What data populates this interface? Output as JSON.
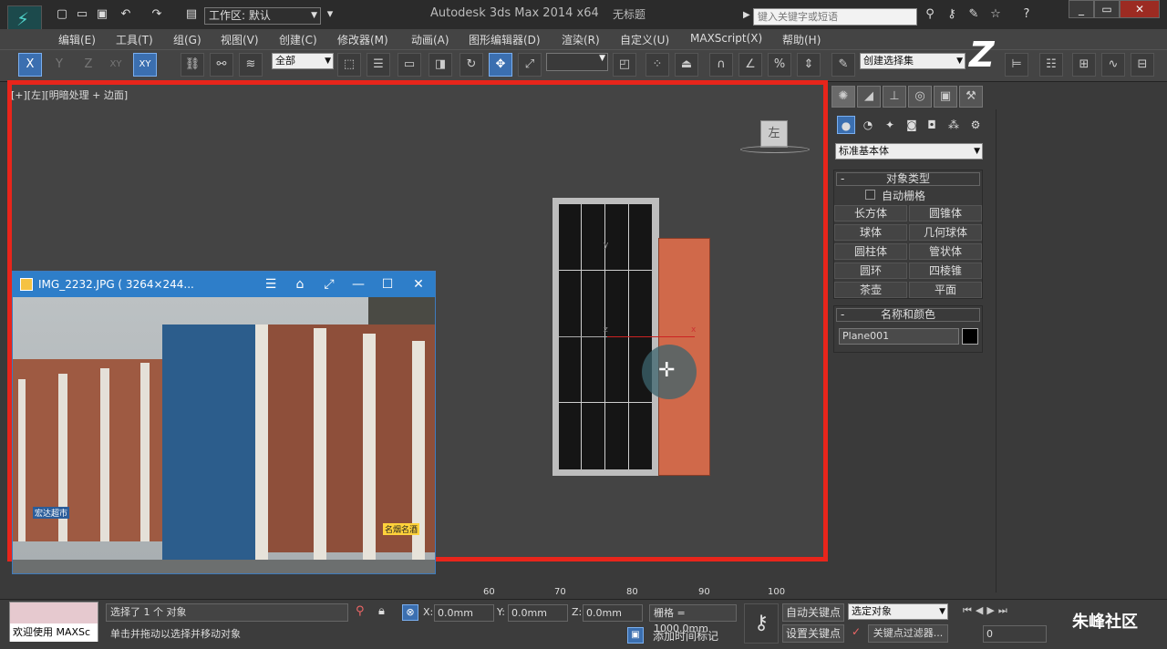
{
  "app": {
    "title": "Autodesk 3ds Max  2014 x64",
    "document": "无标题",
    "workspace": "工作区: 默认",
    "search_placeholder": "键入关键字或短语"
  },
  "menus": [
    "编辑(E)",
    "工具(T)",
    "组(G)",
    "视图(V)",
    "创建(C)",
    "修改器(M)",
    "动画(A)",
    "图形编辑器(D)",
    "渲染(R)",
    "自定义(U)",
    "MAXScript(X)",
    "帮助(H)"
  ],
  "toolbar": {
    "axis_x": "X",
    "axis_y": "Y",
    "axis_z": "Z",
    "axis_xy": "XY",
    "axis_xy2": "XY",
    "filter": "全部",
    "selection_set": "创建选择集"
  },
  "viewport": {
    "label": "[+][左][明暗处理 + 边面]",
    "viewcube": "左",
    "axis_y": "y",
    "axis_z": "z",
    "axis_x": "x"
  },
  "image_window": {
    "title": "IMG_2232.JPG ( 3264×244...",
    "sign1": "宏达超市",
    "sign2": "名烟名酒"
  },
  "timeline": {
    "ticks": [
      "60",
      "70",
      "80",
      "90",
      "100"
    ]
  },
  "command_panel": {
    "primitive_type": "标准基本体",
    "object_type_header": "对象类型",
    "autogrid": "自动栅格",
    "buttons": [
      "长方体",
      "圆锥体",
      "球体",
      "几何球体",
      "圆柱体",
      "管状体",
      "圆环",
      "四棱锥",
      "茶壶",
      "平面"
    ],
    "name_color_header": "名称和颜色",
    "object_name": "Plane001"
  },
  "status": {
    "maxscript": "欢迎使用 MAXSc",
    "selected": "选择了 1 个 对象",
    "prompt": "单击并拖动以选择并移动对象",
    "x_label": "X:",
    "x_value": "0.0mm",
    "y_label": "Y:",
    "y_value": "0.0mm",
    "z_label": "Z:",
    "z_value": "0.0mm",
    "grid": "栅格 = 1000.0mm",
    "add_time_tag": "添加时间标记",
    "auto_key": "自动关键点",
    "set_key": "设置关键点",
    "key_mode": "选定对象",
    "key_filter": "关键点过滤器...",
    "frame": "0",
    "watermark": "朱峰社区"
  },
  "colors": {
    "accent": "#3b6fb0",
    "highlight_border": "#e8251b",
    "plane": "#d0694a",
    "image_titlebar": "#2e7ec9"
  }
}
